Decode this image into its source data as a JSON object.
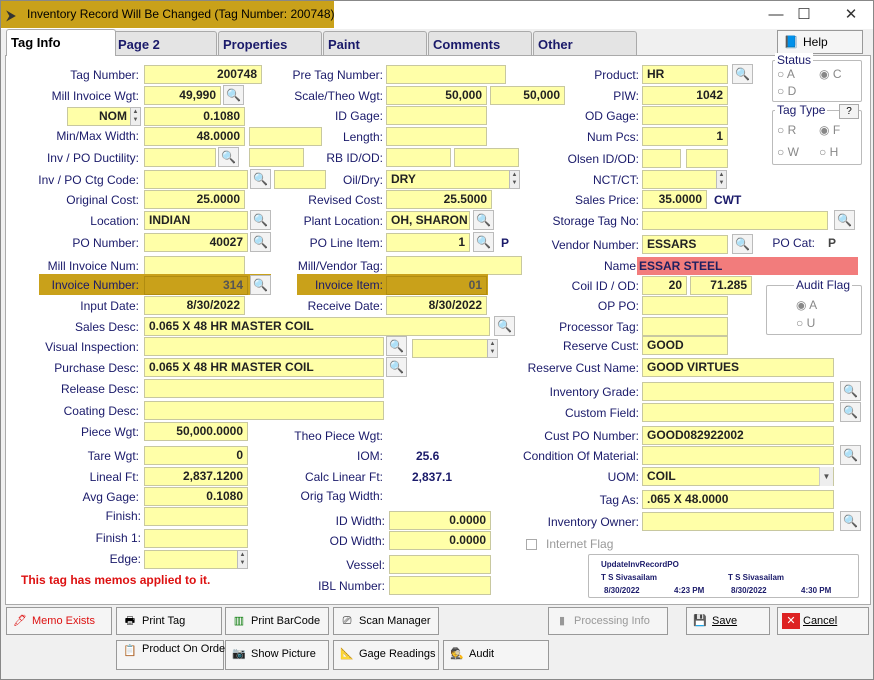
{
  "window": {
    "title": "Inventory Record Will Be Changed  (Tag Number: 200748)",
    "minimize": "—",
    "maximize": "☐",
    "close": "✕"
  },
  "tabs": [
    "Tag Info",
    "Page 2",
    "Properties",
    "Paint",
    "Comments",
    "Other"
  ],
  "help": "Help",
  "left": {
    "tag_number": {
      "label": "Tag Number:",
      "value": "200748"
    },
    "mill_invoice_wgt": {
      "label": "Mill Invoice Wgt:",
      "value": "49,990"
    },
    "nom": {
      "value": "NOM",
      "value2": "0.1080"
    },
    "min_max_width": {
      "label": "Min/Max Width:",
      "value": "48.0000",
      "value2": ""
    },
    "inv_po_ductility": {
      "label": "Inv / PO Ductility:",
      "value": ""
    },
    "inv_po_ctg_code": {
      "label": "Inv / PO Ctg Code:",
      "value": ""
    },
    "original_cost": {
      "label": "Original Cost:",
      "value": "25.0000"
    },
    "location": {
      "label": "Location:",
      "value": "INDIAN"
    },
    "po_number": {
      "label": "PO Number:",
      "value": "40027"
    },
    "mill_invoice_num": {
      "label": "Mill Invoice Num:",
      "value": ""
    },
    "invoice_number": {
      "label": "Invoice Number:",
      "value": "314"
    },
    "input_date": {
      "label": "Input Date:",
      "value": "8/30/2022"
    },
    "sales_desc": {
      "label": "Sales Desc:",
      "value": "0.065 X 48 HR MASTER COIL"
    },
    "visual_inspection": {
      "label": "Visual Inspection:",
      "value": ""
    },
    "purchase_desc": {
      "label": "Purchase Desc:",
      "value": "0.065 X 48 HR MASTER COIL"
    },
    "release_desc": {
      "label": "Release Desc:",
      "value": ""
    },
    "coating_desc": {
      "label": "Coating Desc:",
      "value": ""
    },
    "piece_wgt": {
      "label": "Piece Wgt:",
      "value": "50,000.0000"
    },
    "tare_wgt": {
      "label": "Tare Wgt:",
      "value": "0"
    },
    "lineal_ft": {
      "label": "Lineal Ft:",
      "value": "2,837.1200"
    },
    "avg_gage": {
      "label": "Avg Gage:",
      "value": "0.1080"
    },
    "finish": {
      "label": "Finish:",
      "value": ""
    },
    "finish1": {
      "label": "Finish 1:",
      "value": ""
    },
    "edge": {
      "label": "Edge:",
      "value": ""
    },
    "memo_notice": "This tag has memos applied to it."
  },
  "mid": {
    "pre_tag_number": {
      "label": "Pre Tag Number:",
      "value": ""
    },
    "scale_theo_wgt": {
      "label": "Scale/Theo Wgt:",
      "value": "50,000",
      "value2": "50,000"
    },
    "id_gage": {
      "label": "ID Gage:",
      "value": ""
    },
    "length": {
      "label": "Length:",
      "value": ""
    },
    "rb_id_od": {
      "label": "RB ID/OD:",
      "value": "",
      "value2": ""
    },
    "oil_dry": {
      "label": "Oil/Dry:",
      "value": "DRY"
    },
    "revised_cost": {
      "label": "Revised Cost:",
      "value": "25.5000"
    },
    "plant_location": {
      "label": "Plant Location:",
      "value": "OH, SHARON"
    },
    "po_line_item": {
      "label": "PO Line Item:",
      "value": "1",
      "suffix": "P"
    },
    "mill_vendor_tag": {
      "label": "Mill/Vendor Tag:",
      "value": ""
    },
    "invoice_item": {
      "label": "Invoice Item:",
      "value": "01"
    },
    "receive_date": {
      "label": "Receive Date:",
      "value": "8/30/2022"
    },
    "theo_piece_wgt": {
      "label": "Theo Piece Wgt:",
      "value": ""
    },
    "iom": {
      "label": "IOM:",
      "value": "25.6"
    },
    "calc_linear_ft": {
      "label": "Calc Linear Ft:",
      "value": "2,837.1"
    },
    "orig_tag_width": {
      "label": "Orig Tag Width:",
      "value": ""
    },
    "id_width": {
      "label": "ID Width:",
      "value": "0.0000"
    },
    "od_width": {
      "label": "OD Width:",
      "value": "0.0000"
    },
    "vessel": {
      "label": "Vessel:",
      "value": ""
    },
    "ibl_number": {
      "label": "IBL Number:",
      "value": ""
    }
  },
  "right": {
    "product": {
      "label": "Product:",
      "value": "HR"
    },
    "piw": {
      "label": "PIW:",
      "value": "1042"
    },
    "od_gage": {
      "label": "OD Gage:",
      "value": ""
    },
    "num_pcs": {
      "label": "Num Pcs:",
      "value": "1"
    },
    "olsen_id_od": {
      "label": "Olsen ID/OD:",
      "value": "",
      "value2": ""
    },
    "nct_ct": {
      "label": "NCT/CT:",
      "value": ""
    },
    "sales_price": {
      "label": "Sales Price:",
      "value": "35.0000",
      "unit": "CWT"
    },
    "storage_tag_no": {
      "label": "Storage Tag No:",
      "value": ""
    },
    "vendor_number": {
      "label": "Vendor Number:",
      "value": "ESSARS"
    },
    "po_cat": {
      "label": "PO Cat:",
      "value": "P"
    },
    "name": {
      "label": "Name",
      "value": "ESSAR STEEL"
    },
    "coil_id_od": {
      "label": "Coil ID / OD:",
      "value": "20",
      "value2": "71.285"
    },
    "op_po": {
      "label": "OP PO:",
      "value": ""
    },
    "processor_tag": {
      "label": "Processor Tag:",
      "value": ""
    },
    "reserve_cust": {
      "label": "Reserve Cust:",
      "value": "GOOD"
    },
    "reserve_cust_name": {
      "label": "Reserve Cust Name:",
      "value": "GOOD VIRTUES"
    },
    "inventory_grade": {
      "label": "Inventory Grade:",
      "value": ""
    },
    "custom_field": {
      "label": "Custom Field:",
      "value": ""
    },
    "cust_po_number": {
      "label": "Cust PO Number:",
      "value": "GOOD082922002"
    },
    "condition_of_material": {
      "label": "Condition Of Material:",
      "value": ""
    },
    "uom": {
      "label": "UOM:",
      "value": "COIL"
    },
    "tag_as": {
      "label": "Tag As:",
      "value": ".065 X 48.0000"
    },
    "inventory_owner": {
      "label": "Inventory Owner:",
      "value": ""
    },
    "internet_flag": "Internet Flag"
  },
  "status": {
    "title": "Status",
    "a": "A",
    "c": "C",
    "d": "D"
  },
  "tag_type": {
    "title": "Tag Type",
    "help": "?",
    "r": "R",
    "f": "F",
    "w": "W",
    "h": "H"
  },
  "audit_flag": {
    "title": "Audit Flag",
    "a": "A",
    "u": "U"
  },
  "update_box": {
    "title": "UpdateInvRecordPO",
    "user1": "T S Sivasailam",
    "date1": "8/30/2022",
    "time1": "4:23 PM",
    "user2": "T S Sivasailam",
    "date2": "8/30/2022",
    "time2": "4:30 PM"
  },
  "buttons": {
    "memo_exists": "Memo Exists",
    "print_tag": "Print Tag",
    "print_barcode": "Print BarCode",
    "scan_manager": "Scan Manager",
    "processing_info": "Processing Info",
    "save": "Save",
    "cancel": "Cancel",
    "product_on_order": "Product On Order",
    "show_picture": "Show Picture",
    "gage_readings": "Gage Readings",
    "audit": "Audit"
  },
  "colors": {
    "field": "#ffffa8",
    "highlight": "#c9a11a",
    "name_bar": "#f27c7c",
    "label": "#1a1a6a",
    "memo": "#dd1111"
  }
}
